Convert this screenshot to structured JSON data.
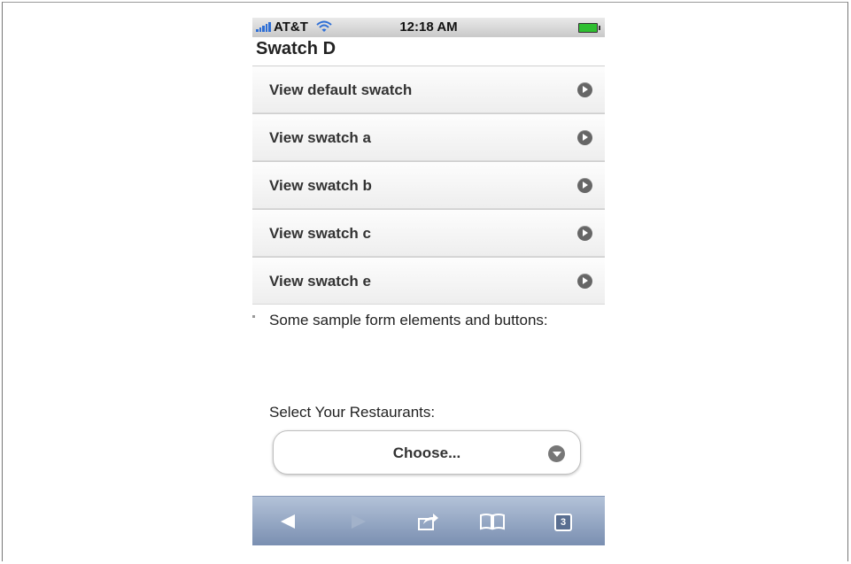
{
  "status_bar": {
    "carrier": "AT&T",
    "time": "12:18 AM"
  },
  "page": {
    "title": "Swatch D"
  },
  "list": [
    {
      "label": "View default swatch"
    },
    {
      "label": "View swatch a"
    },
    {
      "label": "View swatch b"
    },
    {
      "label": "View swatch c"
    },
    {
      "label": "View swatch e"
    }
  ],
  "content": {
    "intro": "Some sample form elements and buttons:",
    "select_label": "Select Your Restaurants:",
    "select_value": "Choose..."
  },
  "toolbar": {
    "tabs_count": "3",
    "icons": [
      "back-icon",
      "forward-icon",
      "share-icon",
      "bookmarks-icon",
      "tabs-icon"
    ]
  },
  "colors": {
    "toolbar": "#8a9dbd",
    "battery": "#2fbf31",
    "signal": "#2e6fd6"
  }
}
